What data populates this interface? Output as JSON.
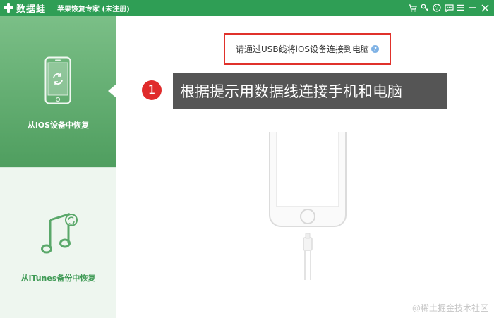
{
  "titlebar": {
    "brand": "数据蛙",
    "title": "苹果恢复专家 (未注册)",
    "icons": [
      "cart-icon",
      "key-icon",
      "help-icon",
      "chat-icon",
      "menu-icon",
      "minimize-icon",
      "close-icon"
    ]
  },
  "sidebar": {
    "items": [
      {
        "label": "从iOS设备中恢复",
        "icon": "phone-restore-icon",
        "active": true
      },
      {
        "label": "从iTunes备份中恢复",
        "icon": "itunes-music-icon",
        "active": false
      }
    ]
  },
  "main": {
    "instruction": "请通过USB线将iOS设备连接到电脑",
    "step_number": "1",
    "tooltip": "根据提示用数据线连接手机和电脑"
  },
  "watermark": "@稀土掘金技术社区",
  "colors": {
    "accent": "#2f9e55",
    "sidebar_active_top": "#7bbf87",
    "sidebar_active_bottom": "#4f9e5f",
    "highlight_border": "#e0312b",
    "step_badge": "#e02b2b",
    "tooltip_bg": "#555555"
  }
}
